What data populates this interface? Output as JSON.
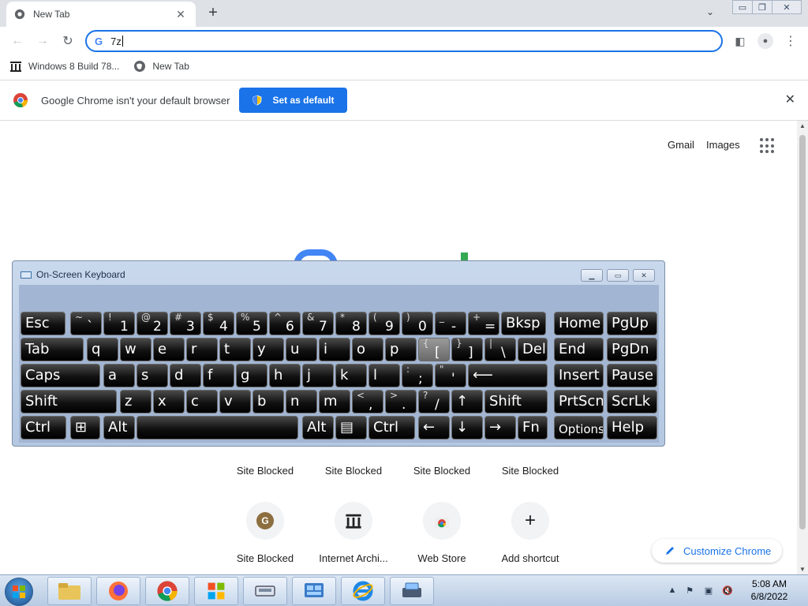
{
  "tab": {
    "title": "New Tab",
    "close": "✕",
    "new_tab": "+",
    "search_tabs": "⌄"
  },
  "window_controls": {
    "minimize": "▭",
    "restore": "❐",
    "close": "✕"
  },
  "toolbar": {
    "back": "←",
    "forward": "→",
    "reload": "↻",
    "menu": "⋮",
    "side_panel": "◧",
    "profile": "●"
  },
  "omnibox": {
    "icon": "G",
    "value": "7z"
  },
  "bookmarks": [
    {
      "label": "Windows 8 Build 78...",
      "icon": "archive-icon"
    },
    {
      "label": "New Tab",
      "icon": "globe-icon"
    }
  ],
  "infobar": {
    "message": "Google Chrome isn't your default browser",
    "button": "Set as default",
    "close": "✕"
  },
  "ntp": {
    "links": {
      "gmail": "Gmail",
      "images": "Images"
    },
    "shortcuts_row1": [
      "Site Blocked",
      "Site Blocked",
      "Site Blocked",
      "Site Blocked"
    ],
    "shortcuts_row2": [
      {
        "label": "Site Blocked",
        "glyph": "G"
      },
      {
        "label": "Internet Archi...",
        "glyph": "🏛"
      },
      {
        "label": "Web Store",
        "glyph": ""
      },
      {
        "label": "Add shortcut",
        "glyph": "+"
      }
    ],
    "customize": "Customize Chrome"
  },
  "osk": {
    "title": "On-Screen Keyboard",
    "rows": [
      [
        {
          "m": "Esc"
        },
        {
          "s": "~",
          "b": "`"
        },
        {
          "s": "!",
          "b": "1"
        },
        {
          "s": "@",
          "b": "2"
        },
        {
          "s": "#",
          "b": "3"
        },
        {
          "s": "$",
          "b": "4"
        },
        {
          "s": "%",
          "b": "5"
        },
        {
          "s": "^",
          "b": "6"
        },
        {
          "s": "&",
          "b": "7"
        },
        {
          "s": "*",
          "b": "8"
        },
        {
          "s": "(",
          "b": "9"
        },
        {
          "s": ")",
          "b": "0"
        },
        {
          "s": "_",
          "b": "-"
        },
        {
          "s": "+",
          "b": "="
        },
        {
          "m": "Bksp"
        },
        {
          "m": "Home"
        },
        {
          "m": "PgUp"
        }
      ],
      [
        {
          "m": "Tab"
        },
        {
          "m": "q"
        },
        {
          "m": "w"
        },
        {
          "m": "e"
        },
        {
          "m": "r"
        },
        {
          "m": "t"
        },
        {
          "m": "y"
        },
        {
          "m": "u"
        },
        {
          "m": "i"
        },
        {
          "m": "o"
        },
        {
          "m": "p"
        },
        {
          "s": "{",
          "b": "["
        },
        {
          "s": "}",
          "b": "]"
        },
        {
          "s": "|",
          "b": "\\"
        },
        {
          "m": "Del"
        },
        {
          "m": "End"
        },
        {
          "m": "PgDn"
        }
      ],
      [
        {
          "m": "Caps"
        },
        {
          "m": "a"
        },
        {
          "m": "s"
        },
        {
          "m": "d"
        },
        {
          "m": "f"
        },
        {
          "m": "g"
        },
        {
          "m": "h"
        },
        {
          "m": "j"
        },
        {
          "m": "k"
        },
        {
          "m": "l"
        },
        {
          "s": ":",
          "b": ";"
        },
        {
          "s": "\"",
          "b": "'"
        },
        {
          "m": "⟵"
        },
        {
          "m": "Insert"
        },
        {
          "m": "Pause"
        }
      ],
      [
        {
          "m": "Shift"
        },
        {
          "m": "z"
        },
        {
          "m": "x"
        },
        {
          "m": "c"
        },
        {
          "m": "v"
        },
        {
          "m": "b"
        },
        {
          "m": "n"
        },
        {
          "m": "m"
        },
        {
          "s": "<",
          "b": ","
        },
        {
          "s": ">",
          "b": "."
        },
        {
          "s": "?",
          "b": "/"
        },
        {
          "m": "↑"
        },
        {
          "m": "Shift"
        },
        {
          "m": "PrtScn"
        },
        {
          "m": "ScrLk"
        }
      ],
      [
        {
          "m": "Ctrl"
        },
        {
          "m": "⊞"
        },
        {
          "m": "Alt"
        },
        {
          "m": ""
        },
        {
          "m": "Alt"
        },
        {
          "m": "▤"
        },
        {
          "m": "Ctrl"
        },
        {
          "m": "←"
        },
        {
          "m": "↓"
        },
        {
          "m": "→"
        },
        {
          "m": "Fn"
        },
        {
          "m": "Options"
        },
        {
          "m": "Help"
        }
      ]
    ]
  },
  "taskbar": {
    "time": "5:08 AM",
    "date": "6/8/2022",
    "tray": [
      "▲",
      "⚑",
      "▣",
      "🔇"
    ]
  }
}
